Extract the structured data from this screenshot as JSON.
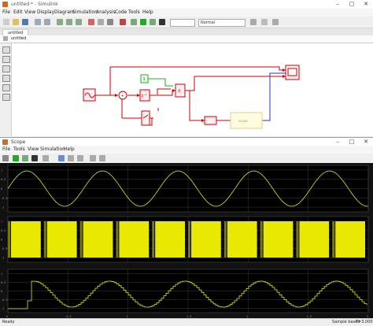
{
  "sim_window": {
    "title": "untitled * - Simulink",
    "menu": [
      "File",
      "Edit",
      "View",
      "Display",
      "Diagram",
      "Simulation",
      "Analysis",
      "Code",
      "Tools",
      "Help"
    ],
    "tab": "untitled",
    "breadcrumb": "untitled",
    "mode_select": "Normal",
    "blocks": {
      "constant": "1",
      "product": "X",
      "gain": "z⁻¹",
      "function": "scope"
    }
  },
  "scope_window": {
    "title": "Scope",
    "menu": [
      "File",
      "Tools",
      "View",
      "Simulation",
      "Help"
    ],
    "plots": [
      {
        "yticks": [
          "1",
          "0.5",
          "0",
          "-0.5",
          "-1"
        ]
      },
      {
        "yticks": [
          "1",
          "0.5",
          "0",
          "-0.5",
          "-1"
        ]
      },
      {
        "yticks": [
          "1",
          "0.5",
          "0",
          "-0.5",
          "-1"
        ]
      }
    ],
    "xticks": [
      "0",
      "0.5",
      "1",
      "1.5",
      "2",
      "2.5",
      "3"
    ],
    "status_left": "Ready",
    "status_sample": "Sample based",
    "status_time": "T=3.000"
  },
  "colors": {
    "trace": "#e8e800",
    "signal_line": "#cc0000",
    "grid": "#3a3a3a"
  }
}
